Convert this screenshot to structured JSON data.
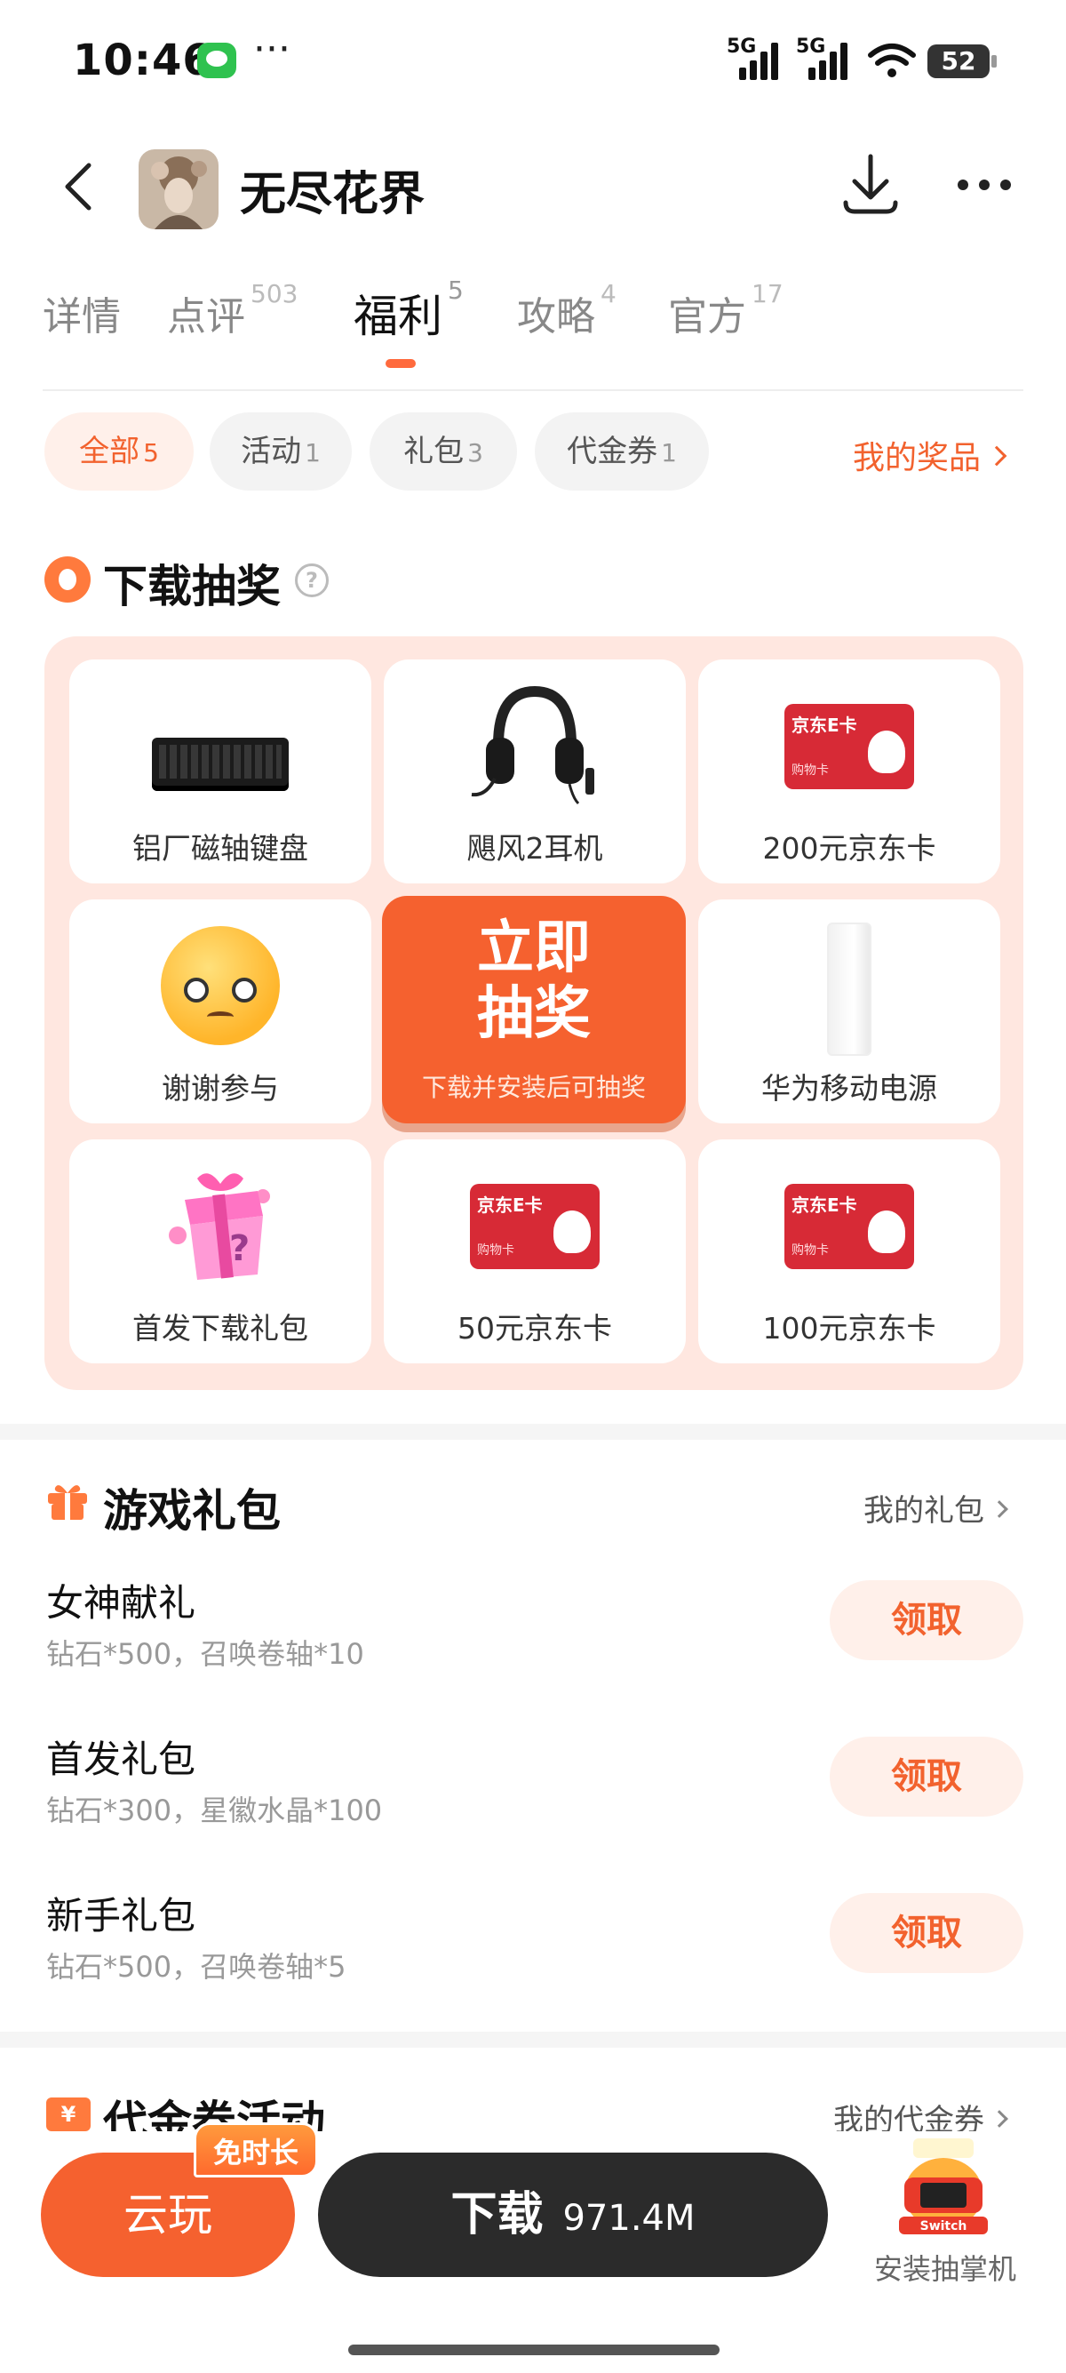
{
  "status_bar": {
    "time": "10:46",
    "overflow": "···",
    "signal1": "5G",
    "signal2": "5G",
    "battery": "52"
  },
  "header": {
    "title": "无尽花界"
  },
  "tabs": [
    {
      "label": "详情",
      "count": ""
    },
    {
      "label": "点评",
      "count": "503"
    },
    {
      "label": "福利",
      "count": "5"
    },
    {
      "label": "攻略",
      "count": "4"
    },
    {
      "label": "官方",
      "count": "17"
    }
  ],
  "active_tab": "福利",
  "filters": [
    {
      "label": "全部",
      "count": "5"
    },
    {
      "label": "活动",
      "count": "1"
    },
    {
      "label": "礼包",
      "count": "3"
    },
    {
      "label": "代金券",
      "count": "1"
    }
  ],
  "prizes_link": "我的奖品",
  "lottery": {
    "title": "下载抽奖",
    "prizes": [
      {
        "label": "铝厂磁轴键盘",
        "icon": "keyboard"
      },
      {
        "label": "飓风2耳机",
        "icon": "headset"
      },
      {
        "label": "200元京东卡",
        "icon": "jd-card"
      },
      {
        "label": "谢谢参与",
        "icon": "sad-emoji"
      },
      {
        "label": "华为移动电源",
        "icon": "power-bank"
      },
      {
        "label": "首发下载礼包",
        "icon": "gift-box"
      },
      {
        "label": "50元京东卡",
        "icon": "jd-card"
      },
      {
        "label": "100元京东卡",
        "icon": "jd-card"
      }
    ],
    "jd_card_title": "京东E卡",
    "jd_card_sub": "购物卡",
    "draw_title_line1": "立即",
    "draw_title_line2": "抽奖",
    "draw_sub": "下载并安装后可抽奖"
  },
  "gift_section": {
    "title": "游戏礼包",
    "link": "我的礼包",
    "packs": [
      {
        "name": "女神献礼",
        "desc": "钻石*500，召唤卷轴*10",
        "action": "领取"
      },
      {
        "name": "首发礼包",
        "desc": "钻石*300，星徽水晶*100",
        "action": "领取"
      },
      {
        "name": "新手礼包",
        "desc": "钻石*500，召唤卷轴*5",
        "action": "领取"
      }
    ]
  },
  "voucher_section": {
    "title": "代金券活动",
    "link": "我的代金券",
    "icon_glyph": "¥"
  },
  "bottom": {
    "cloud_label": "云玩",
    "free_badge": "免时长",
    "download_label": "下载",
    "download_size": "971.4M",
    "promo_label": "安装抽掌机"
  },
  "colors": {
    "accent": "#f5612f",
    "accent_light": "#fff0ea",
    "board_bg": "#ffe7e0",
    "dark_button": "#2b2b2b"
  }
}
